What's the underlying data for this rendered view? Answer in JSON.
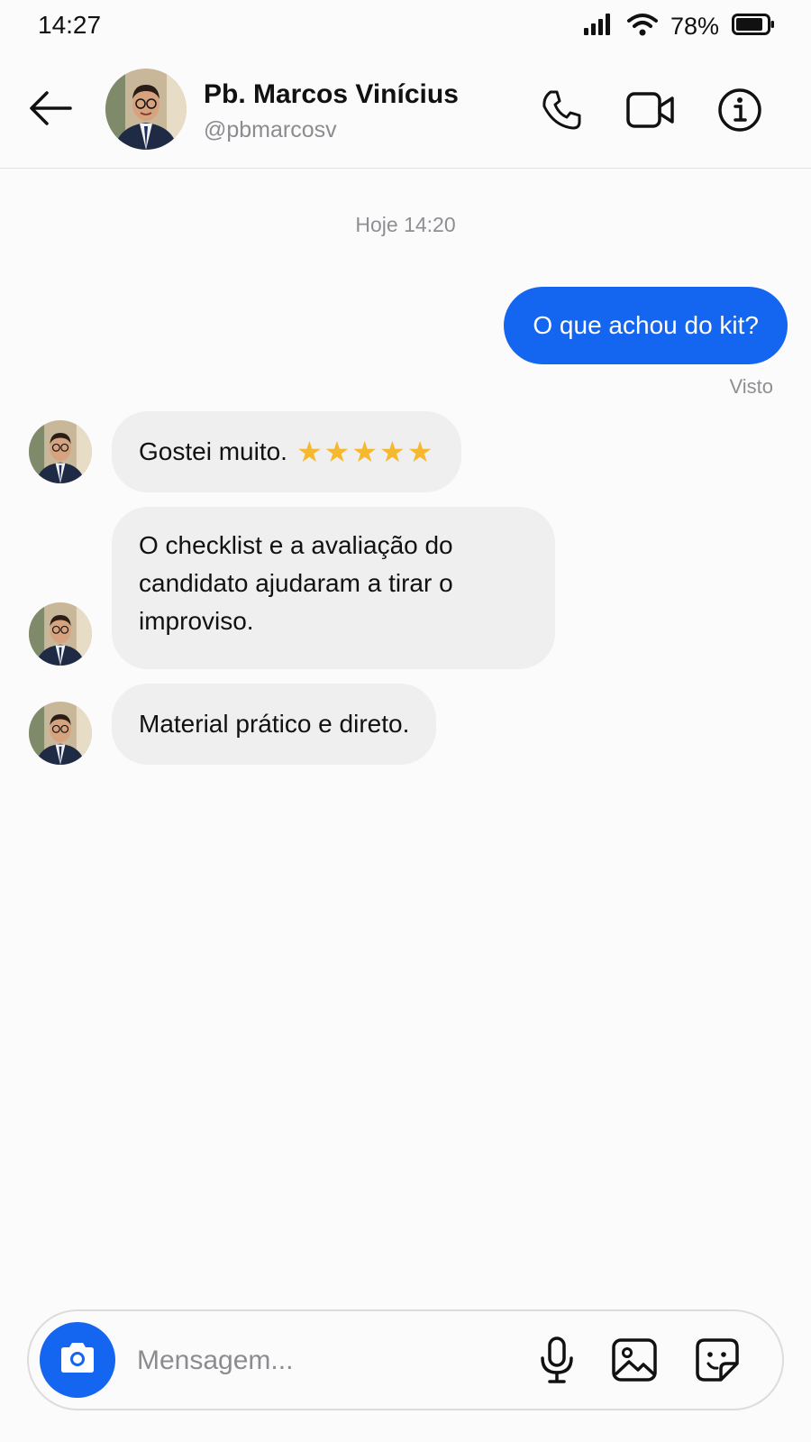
{
  "status_bar": {
    "time": "14:27",
    "battery_percent": "78%",
    "icons": [
      "signal-icon",
      "wifi-icon",
      "battery-icon"
    ]
  },
  "header": {
    "contact_name": "Pb. Marcos Vinícius",
    "contact_handle": "@pbmarcosv",
    "icons": [
      "back-arrow-icon",
      "phone-icon",
      "video-camera-icon",
      "info-icon"
    ]
  },
  "conversation": {
    "date_separator": "Hoje 14:20",
    "outgoing": [
      {
        "text": "O que achou do kit?",
        "status": "Visto"
      }
    ],
    "incoming": [
      {
        "text": "Gostei muito.",
        "stars": "★★★★★",
        "rating": 5
      },
      {
        "lines": [
          "O checklist e a avaliação do",
          "candidato ajudaram a tirar o",
          "improviso."
        ]
      },
      {
        "text": "Material prático e direto."
      }
    ]
  },
  "composer": {
    "placeholder": "Mensagem...",
    "icons": [
      "camera-icon",
      "microphone-icon",
      "image-icon",
      "sticker-icon"
    ]
  },
  "colors": {
    "accent": "#1465f0",
    "incoming_bubble": "#efeff0",
    "star": "#f5b82e",
    "muted_text": "#8e8e93"
  }
}
